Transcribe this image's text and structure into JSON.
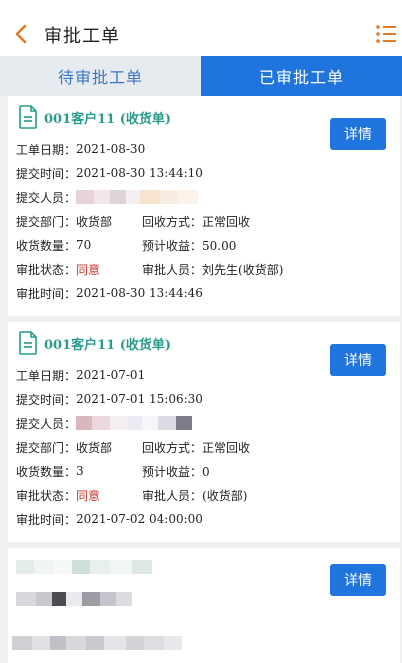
{
  "header": {
    "title": "审批工单"
  },
  "tabs": [
    {
      "label": "待审批工单",
      "active": false
    },
    {
      "label": "已审批工单",
      "active": true
    }
  ],
  "labels": {
    "date": "工单日期：",
    "submit_time": "提交时间：",
    "submitter": "提交人员：",
    "dept": "提交部门：",
    "recycle": "回收方式：",
    "qty": "收货数量：",
    "income": "预计收益：",
    "status": "审批状态：",
    "approver": "审批人员：",
    "approve_time": "审批时间："
  },
  "detail_label": "详情",
  "orders": [
    {
      "title": "001客户11 (收货单)",
      "date": "2021-08-30",
      "submit_time": "2021-08-30 13:44:10",
      "dept": "收货部",
      "recycle": "正常回收",
      "qty": "70",
      "income": "50.00",
      "status": "同意",
      "approver": "刘先生(收货部)",
      "approve_time": "2021-08-30 13:44:46"
    },
    {
      "title": "001客户11 (收货单)",
      "date": "2021-07-01",
      "submit_time": "2021-07-01 15:06:30",
      "dept": "收货部",
      "recycle": "正常回收",
      "qty": "3",
      "income": "0",
      "status": "同意",
      "approver": "(收货部)",
      "approve_time": "2021-07-02 04:00:00"
    }
  ],
  "colors": {
    "accent": "#1f74de",
    "title_green": "#2a9b8c",
    "status_red": "#c0392b",
    "back_orange": "#e07b2a"
  }
}
